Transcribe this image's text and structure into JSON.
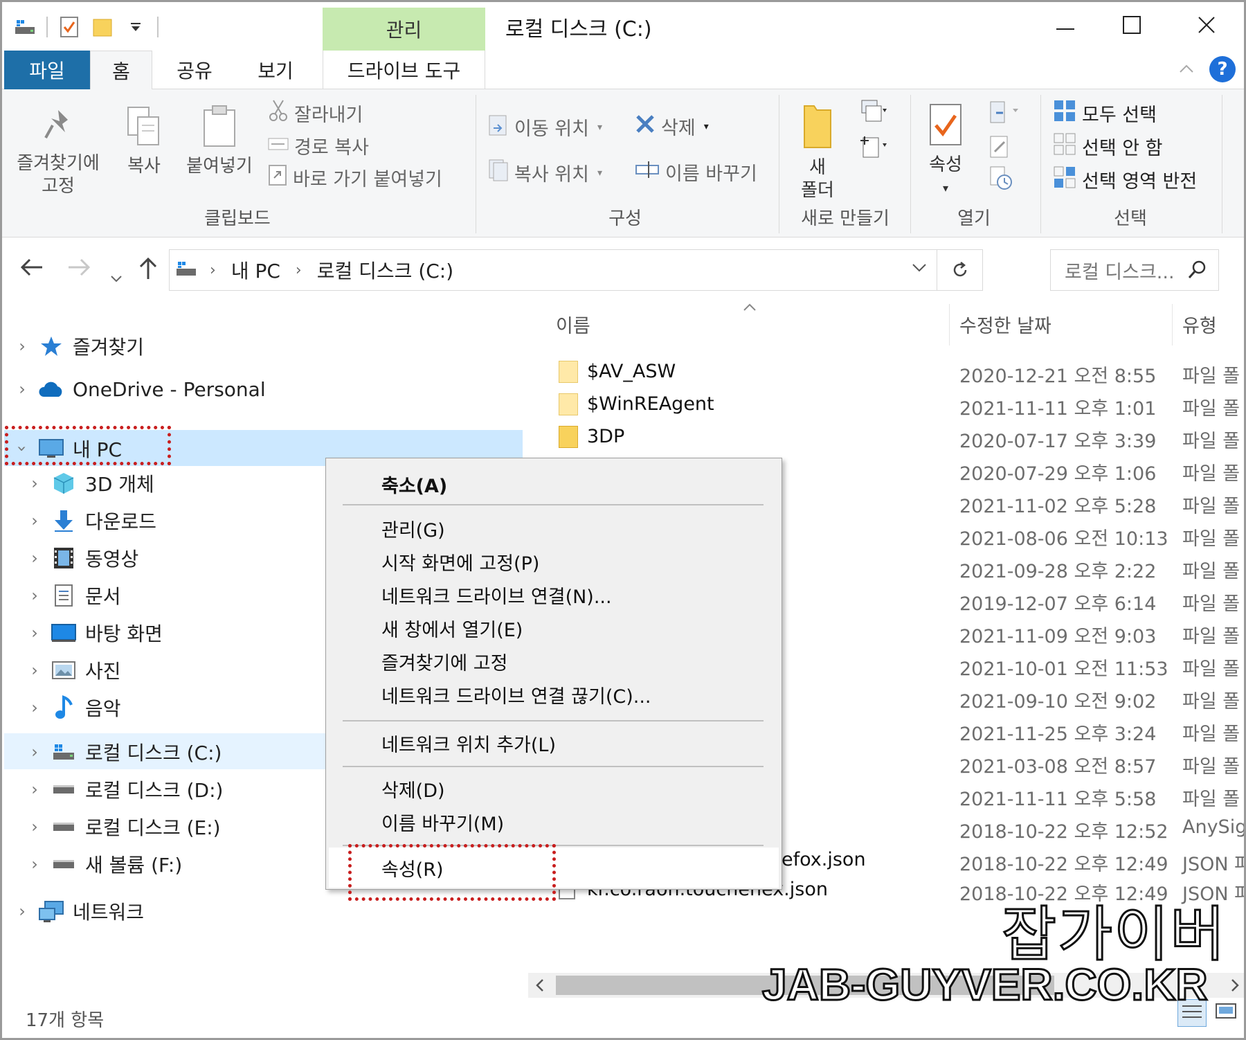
{
  "window": {
    "title": "로컬 디스크 (C:)",
    "context_tab_header": "관리"
  },
  "tabs": {
    "file": "파일",
    "home": "홈",
    "share": "공유",
    "view": "보기",
    "drive_tools": "드라이브 도구"
  },
  "ribbon": {
    "clipboard": {
      "label": "클립보드",
      "pin": "즐겨찾기에\n고정",
      "copy": "복사",
      "paste": "붙여넣기",
      "cut": "잘라내기",
      "copy_path": "경로 복사",
      "paste_shortcut": "바로 가기 붙여넣기"
    },
    "organize": {
      "label": "구성",
      "move_to": "이동 위치",
      "copy_to": "복사 위치",
      "delete": "삭제",
      "rename": "이름 바꾸기"
    },
    "new": {
      "label": "새로 만들기",
      "new_folder_line1": "새",
      "new_folder_line2": "폴더"
    },
    "open": {
      "label": "열기",
      "properties": "속성"
    },
    "select": {
      "label": "선택",
      "select_all": "모두 선택",
      "select_none": "선택 안 함",
      "invert": "선택 영역 반전"
    }
  },
  "address": {
    "crumbs": [
      "내 PC",
      "로컬 디스크 (C:)"
    ],
    "search_placeholder": "로컬 디스크..."
  },
  "nav": {
    "favorites": "즐겨찾기",
    "onedrive": "OneDrive - Personal",
    "this_pc": "내 PC",
    "children": [
      "3D 개체",
      "다운로드",
      "동영상",
      "문서",
      "바탕 화면",
      "사진",
      "음악",
      "로컬 디스크 (C:)",
      "로컬 디스크 (D:)",
      "로컬 디스크 (E:)",
      "새 볼륨 (F:)"
    ],
    "network": "네트워크"
  },
  "file_list": {
    "columns": {
      "name": "이름",
      "modified": "수정한 날짜",
      "type": "유형"
    },
    "rows": [
      {
        "name": "$AV_ASW",
        "date": "2020-12-21 오전 8:55",
        "type": "파일 폴"
      },
      {
        "name": "$WinREAgent",
        "date": "2021-11-11 오후 1:01",
        "type": "파일 폴"
      },
      {
        "name": "3DP",
        "date": "2020-07-17 오후 3:39",
        "type": "파일 폴"
      },
      {
        "name": "",
        "date": "2020-07-29 오후 1:06",
        "type": "파일 폴"
      },
      {
        "name": "",
        "date": "2021-11-02 오후 5:28",
        "type": "파일 폴"
      },
      {
        "name": "",
        "date": "2021-08-06 오전 10:13",
        "type": "파일 폴"
      },
      {
        "name": "",
        "date": "2021-09-28 오후 2:22",
        "type": "파일 폴"
      },
      {
        "name": "",
        "date": "2019-12-07 오후 6:14",
        "type": "파일 폴"
      },
      {
        "name": "",
        "date": "2021-11-09 오전 9:03",
        "type": "파일 폴"
      },
      {
        "name": "",
        "date": "2021-10-01 오전 11:53",
        "type": "파일 폴"
      },
      {
        "name": "",
        "date": "2021-09-10 오전 9:02",
        "type": "파일 폴"
      },
      {
        "name": "",
        "date": "2021-11-25 오후 3:24",
        "type": "파일 폴"
      },
      {
        "name": "",
        "date": "2021-03-08 오전 8:57",
        "type": "파일 폴"
      },
      {
        "name": "",
        "date": "2021-11-11 오후 5:58",
        "type": "파일 폴"
      },
      {
        "name": "",
        "date": "2018-10-22 오후 12:52",
        "type": "AnySig"
      },
      {
        "name": "efox.json",
        "date": "2018-10-22 오후 12:49",
        "type": "JSON 파"
      },
      {
        "name": "kr.co.raon.touchenex.json",
        "date": "2018-10-22 오후 12:49",
        "type": "JSON 파"
      }
    ]
  },
  "status": {
    "item_count": "17개 항목"
  },
  "context_menu": {
    "collapse": "축소(A)",
    "manage": "관리(G)",
    "pin_start": "시작 화면에 고정(P)",
    "map_drive": "네트워크 드라이브 연결(N)...",
    "open_new_window": "새 창에서 열기(E)",
    "pin_quick": "즐겨찾기에 고정",
    "disconnect_drive": "네트워크 드라이브 연결 끊기(C)...",
    "add_network_location": "네트워크 위치 추가(L)",
    "delete": "삭제(D)",
    "rename": "이름 바꾸기(M)",
    "properties": "속성(R)"
  },
  "watermark": {
    "korean": "잡가이버",
    "url": "JAB-GUYVER.CO.KR"
  },
  "colors": {
    "file_tab": "#1e6fa8",
    "context_header": "#c7eab0",
    "selection": "#cce8ff",
    "annotation": "#c81e1e"
  }
}
